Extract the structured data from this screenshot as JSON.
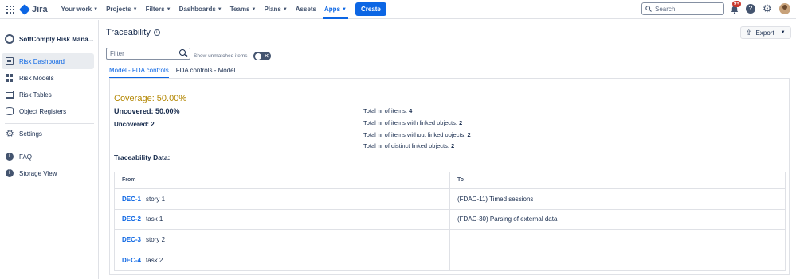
{
  "topnav": {
    "logo_text": "Jira",
    "items": [
      {
        "label": "Your work",
        "dropdown": true
      },
      {
        "label": "Projects",
        "dropdown": true
      },
      {
        "label": "Filters",
        "dropdown": true
      },
      {
        "label": "Dashboards",
        "dropdown": true
      },
      {
        "label": "Teams",
        "dropdown": true
      },
      {
        "label": "Plans",
        "dropdown": true
      },
      {
        "label": "Assets",
        "dropdown": false
      },
      {
        "label": "Apps",
        "dropdown": true,
        "active": true
      }
    ],
    "create_label": "Create",
    "search_placeholder": "Search",
    "notification_badge": "9+",
    "accent_color": "#0c66e4"
  },
  "sidebar": {
    "project_name": "SoftComply Risk Mana...",
    "items": [
      {
        "label": "Risk Dashboard",
        "icon": "dashboard-icon",
        "active": true
      },
      {
        "label": "Risk Models",
        "icon": "grid-icon"
      },
      {
        "label": "Risk Tables",
        "icon": "table-icon"
      },
      {
        "label": "Object Registers",
        "icon": "database-icon"
      },
      {
        "label": "Settings",
        "icon": "gear-icon"
      },
      {
        "label": "FAQ",
        "icon": "info-icon"
      },
      {
        "label": "Storage View",
        "icon": "info-icon"
      }
    ]
  },
  "main": {
    "title": "Traceability",
    "export_label": "Export",
    "filter_placeholder": "Filter",
    "unmatched_label": "Show unmatched items",
    "tabs": [
      {
        "label": "Model - FDA controls",
        "active": true
      },
      {
        "label": "FDA controls - Model",
        "active": false
      }
    ],
    "coverage": "Coverage: 50.00%",
    "uncovered_pct": "Uncovered: 50.00%",
    "uncovered_count": "Uncovered: 2",
    "stats": [
      {
        "label": "Total nr of items:",
        "value": "4"
      },
      {
        "label": "Total nr of items with linked objects:",
        "value": "2"
      },
      {
        "label": "Total nr of items without linked objects:",
        "value": "2"
      },
      {
        "label": "Total nr of distinct linked objects:",
        "value": "2"
      }
    ],
    "traceability_title": "Traceability Data:",
    "table": {
      "headers": [
        "From",
        "To"
      ],
      "rows": [
        {
          "key": "DEC-1",
          "summary": "story 1",
          "to": "(FDAC-11) Timed sessions"
        },
        {
          "key": "DEC-2",
          "summary": "task 1",
          "to": "(FDAC-30) Parsing of external data"
        },
        {
          "key": "DEC-3",
          "summary": "story 2",
          "to": ""
        },
        {
          "key": "DEC-4",
          "summary": "task 2",
          "to": ""
        }
      ]
    },
    "coverage_color": "#b38600"
  }
}
